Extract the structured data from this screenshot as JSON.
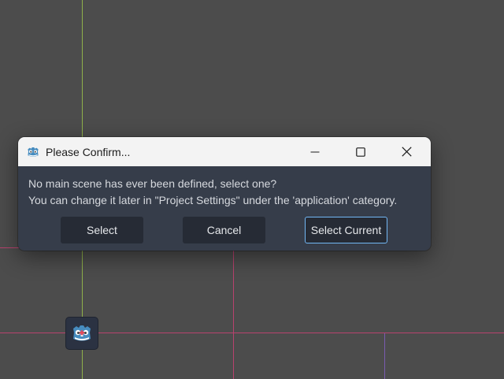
{
  "dialog": {
    "title": "Please Confirm...",
    "message_line1": "No main scene has ever been defined, select one?",
    "message_line2": "You can change it later in \"Project Settings\" under the 'application' category.",
    "buttons": {
      "select": "Select",
      "cancel": "Cancel",
      "select_current": "Select Current"
    },
    "window_controls": [
      "minimize-icon",
      "maximize-icon",
      "close-icon"
    ]
  },
  "colors": {
    "viewport_bg": "#4c4c4c",
    "dialog_bg": "#363d4a",
    "titlebar_bg": "#f3f3f3",
    "button_bg": "#262b35",
    "focus_border": "#72b7f5",
    "guide_green": "#8fb14a",
    "guide_pink": "#b8426e",
    "guide_purple": "#7a5bb0"
  },
  "icons": {
    "app": "godot-logo-icon",
    "node": "godot-node-icon"
  }
}
